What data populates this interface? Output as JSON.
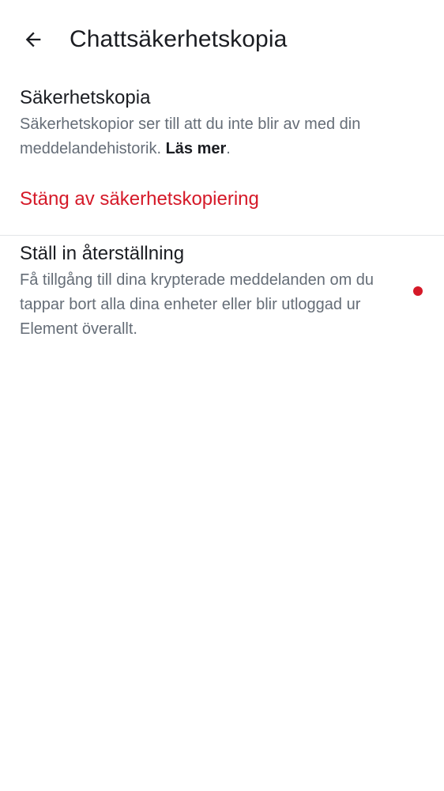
{
  "header": {
    "back_icon": "arrow-left-icon",
    "title": "Chattsäkerhetskopia"
  },
  "backup": {
    "title": "Säkerhetskopia",
    "description": "Säkerhetskopior ser till att du inte blir av med din meddelandehistorik.",
    "learn_more": "Läs mer",
    "learn_more_suffix": ".",
    "disable_action": "Stäng av säkerhetskopiering"
  },
  "recovery": {
    "title": "Ställ in återställning",
    "description": "Få tillgång till dina krypterade meddelanden om du tappar bort alla dina enheter eller blir utloggad ur Element överallt.",
    "indicator_icon": "notification-dot-icon"
  },
  "colors": {
    "primary_text": "#1b1d22",
    "secondary_text": "#656d77",
    "critical": "#d51928",
    "divider": "#e3e5e8",
    "background": "#ffffff"
  }
}
